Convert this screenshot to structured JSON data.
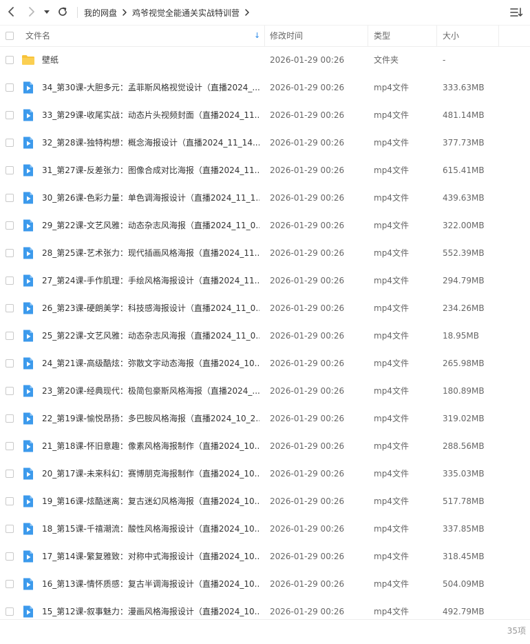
{
  "toolbar": {
    "back_icon": "chevron-left-icon",
    "forward_icon": "chevron-right-icon",
    "history_icon": "caret-down-icon",
    "refresh_icon": "refresh-icon",
    "sort_icon": "sort-list-icon"
  },
  "breadcrumb": [
    {
      "label": "我的网盘"
    },
    {
      "label": "鸡爷视觉全能通关实战特训营"
    }
  ],
  "columns": {
    "name": "文件名",
    "modified": "修改时间",
    "type": "类型",
    "size": "大小",
    "sort_indicator": "↓"
  },
  "colors": {
    "accent": "#2a89e8",
    "folder": "#f8c33a",
    "video": "#3c9aec"
  },
  "files": [
    {
      "name": "壁纸",
      "modified": "2026-01-29 00:26",
      "type": "文件夹",
      "size": "-",
      "icon": "folder-icon"
    },
    {
      "name": "34_第30课-大胆多元：孟菲斯风格视觉设计（直播2024_...",
      "modified": "2026-01-29 00:26",
      "type": "mp4文件",
      "size": "333.63MB",
      "icon": "video-file-icon"
    },
    {
      "name": "33_第29课-收尾实战：动态片头视频封面（直播2024_11...",
      "modified": "2026-01-29 00:26",
      "type": "mp4文件",
      "size": "481.14MB",
      "icon": "video-file-icon"
    },
    {
      "name": "32_第28课-独特构想：概念海报设计（直播2024_11_14...",
      "modified": "2026-01-29 00:26",
      "type": "mp4文件",
      "size": "377.73MB",
      "icon": "video-file-icon"
    },
    {
      "name": "31_第27课-反差张力：图像合成对比海报（直播2024_11...",
      "modified": "2026-01-29 00:26",
      "type": "mp4文件",
      "size": "615.41MB",
      "icon": "video-file-icon"
    },
    {
      "name": "30_第26课-色彩力量：单色调海报设计（直播2024_11_1...",
      "modified": "2026-01-29 00:26",
      "type": "mp4文件",
      "size": "439.63MB",
      "icon": "video-file-icon"
    },
    {
      "name": "29_第22课-文艺风雅：动态杂志风海报（直播2024_11_0...",
      "modified": "2026-01-29 00:26",
      "type": "mp4文件",
      "size": "322.00MB",
      "icon": "video-file-icon"
    },
    {
      "name": "28_第25课-艺术张力：现代插画风格海报（直播2024_11...",
      "modified": "2026-01-29 00:26",
      "type": "mp4文件",
      "size": "552.39MB",
      "icon": "video-file-icon"
    },
    {
      "name": "27_第24课-手作肌理：手绘风格海报设计（直播2024_11...",
      "modified": "2026-01-29 00:26",
      "type": "mp4文件",
      "size": "294.79MB",
      "icon": "video-file-icon"
    },
    {
      "name": "26_第23课-硬朗美学：科技感海报设计（直播2024_11_0...",
      "modified": "2026-01-29 00:26",
      "type": "mp4文件",
      "size": "234.26MB",
      "icon": "video-file-icon"
    },
    {
      "name": "25_第22课-文艺风雅：动态杂志风海报（直播2024_11_0...",
      "modified": "2026-01-29 00:26",
      "type": "mp4文件",
      "size": "18.95MB",
      "icon": "video-file-icon"
    },
    {
      "name": "24_第21课-高级酷炫：弥散文字动态海报（直播2024_10...",
      "modified": "2026-01-29 00:26",
      "type": "mp4文件",
      "size": "265.98MB",
      "icon": "video-file-icon"
    },
    {
      "name": "23_第20课-经典现代：极简包豪斯风格海报（直播2024_...",
      "modified": "2026-01-29 00:26",
      "type": "mp4文件",
      "size": "180.89MB",
      "icon": "video-file-icon"
    },
    {
      "name": "22_第19课-愉悦昂扬：多巴胺风格海报（直播2024_10_2...",
      "modified": "2026-01-29 00:26",
      "type": "mp4文件",
      "size": "319.02MB",
      "icon": "video-file-icon"
    },
    {
      "name": "21_第18课-怀旧意趣：像素风格海报制作（直播2024_10...",
      "modified": "2026-01-29 00:26",
      "type": "mp4文件",
      "size": "288.56MB",
      "icon": "video-file-icon"
    },
    {
      "name": "20_第17课-未来科幻：赛博朋克海报制作（直播2024_10...",
      "modified": "2026-01-29 00:26",
      "type": "mp4文件",
      "size": "335.03MB",
      "icon": "video-file-icon"
    },
    {
      "name": "19_第16课-炫酷迷离：复古迷幻风格海报（直播2024_10...",
      "modified": "2026-01-29 00:26",
      "type": "mp4文件",
      "size": "517.78MB",
      "icon": "video-file-icon"
    },
    {
      "name": "18_第15课-千禧潮流：酸性风格海报设计（直播2024_10...",
      "modified": "2026-01-29 00:26",
      "type": "mp4文件",
      "size": "337.85MB",
      "icon": "video-file-icon"
    },
    {
      "name": "17_第14课-繁复雅致：对称中式海报设计（直播2024_10...",
      "modified": "2026-01-29 00:26",
      "type": "mp4文件",
      "size": "318.45MB",
      "icon": "video-file-icon"
    },
    {
      "name": "16_第13课-情怀质感：复古半调海报设计（直播2024_10...",
      "modified": "2026-01-29 00:26",
      "type": "mp4文件",
      "size": "504.09MB",
      "icon": "video-file-icon"
    },
    {
      "name": "15_第12课-叙事魅力：漫画风格海报设计（直播2024_10...",
      "modified": "2026-01-29 00:26",
      "type": "mp4文件",
      "size": "492.79MB",
      "icon": "video-file-icon"
    }
  ],
  "footer": {
    "item_count": "35项"
  }
}
